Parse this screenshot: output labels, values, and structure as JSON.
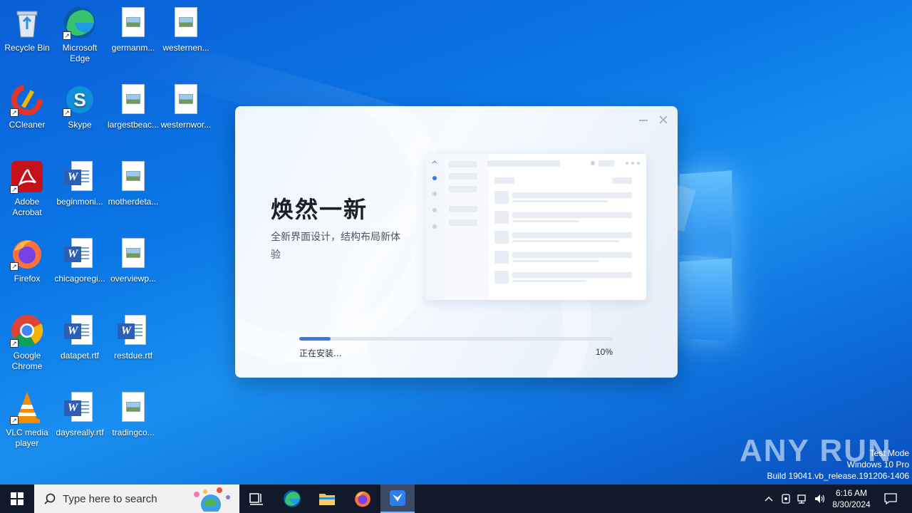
{
  "desktop": {
    "icons": [
      {
        "label": "Recycle Bin",
        "icon": "recycle-bin-icon"
      },
      {
        "label": "Microsoft Edge",
        "icon": "edge-icon"
      },
      {
        "label": "germanm...",
        "icon": "image-file-icon"
      },
      {
        "label": "westernen...",
        "icon": "image-file-icon"
      },
      {
        "label": "CCleaner",
        "icon": "ccleaner-icon"
      },
      {
        "label": "Skype",
        "icon": "skype-icon"
      },
      {
        "label": "largestbeac...",
        "icon": "image-file-icon"
      },
      {
        "label": "westernwor...",
        "icon": "image-file-icon"
      },
      {
        "label": "Adobe Acrobat",
        "icon": "acrobat-icon"
      },
      {
        "label": "beginmoni...",
        "icon": "word-doc-icon"
      },
      {
        "label": "motherdeta...",
        "icon": "image-file-icon"
      },
      {
        "label": "Firefox",
        "icon": "firefox-icon"
      },
      {
        "label": "chicagoregi...",
        "icon": "word-doc-icon"
      },
      {
        "label": "overviewp...",
        "icon": "image-file-icon"
      },
      {
        "label": "Google Chrome",
        "icon": "chrome-icon"
      },
      {
        "label": "datapet.rtf",
        "icon": "word-doc-icon"
      },
      {
        "label": "restdue.rtf",
        "icon": "word-doc-icon"
      },
      {
        "label": "VLC media player",
        "icon": "vlc-icon"
      },
      {
        "label": "daysreally.rtf",
        "icon": "word-doc-icon"
      },
      {
        "label": "tradingco...",
        "icon": "image-file-icon"
      }
    ]
  },
  "installer": {
    "headline": "焕然一新",
    "subline": "全新界面设计，结构布局新体验",
    "status": "正在安装...",
    "percent_label": "10%",
    "progress": 0.1,
    "accent_color": "#3b78e8"
  },
  "watermark": {
    "brand": "ANY RUN",
    "line1": "Test Mode",
    "line2": "Windows 10 Pro",
    "line3": "Build 19041.vb_release.191206-1406"
  },
  "taskbar": {
    "search_placeholder": "Type here to search",
    "time": "6:16 AM",
    "date": "8/30/2024"
  }
}
